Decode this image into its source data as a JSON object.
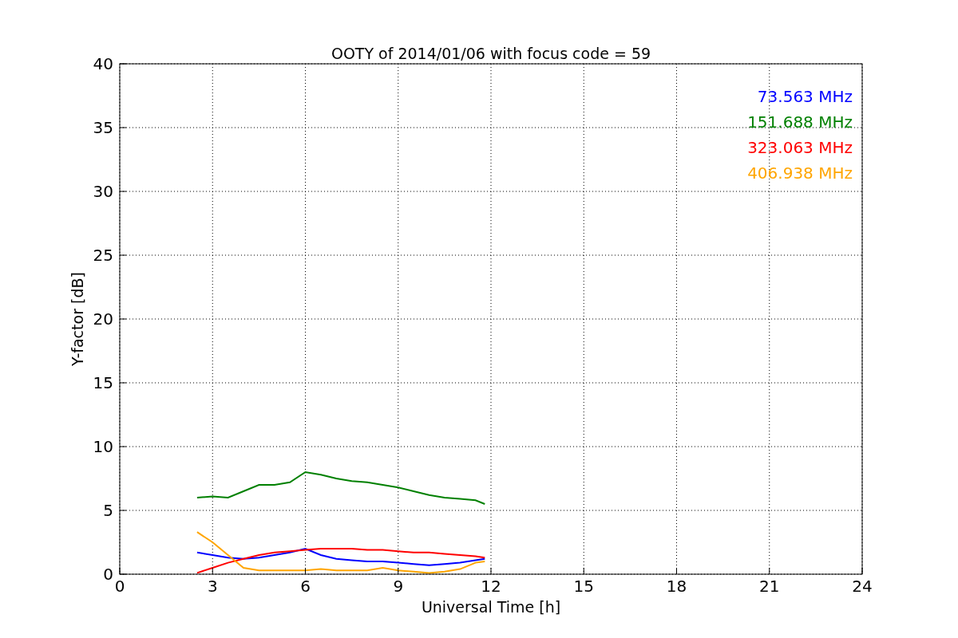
{
  "chart_data": {
    "type": "line",
    "title": "OOTY of 2014/01/06 with focus code = 59",
    "xlabel": "Universal Time [h]",
    "ylabel": "Y-factor [dB]",
    "x": [
      2.5,
      3,
      3.5,
      4,
      4.5,
      5,
      5.5,
      6,
      6.5,
      7,
      7.5,
      8,
      8.5,
      9,
      9.5,
      10,
      10.5,
      11,
      11.5,
      11.8
    ],
    "series": [
      {
        "name": "73.563 MHz",
        "color": "#0000ff",
        "values": [
          1.7,
          1.5,
          1.3,
          1.2,
          1.3,
          1.5,
          1.7,
          2,
          1.5,
          1.2,
          1.1,
          1,
          1,
          0.9,
          0.8,
          0.7,
          0.8,
          0.9,
          1.1,
          1.2
        ]
      },
      {
        "name": "151.688 MHz",
        "color": "#008000",
        "values": [
          6,
          6.1,
          6,
          6.5,
          7,
          7,
          7.2,
          8,
          7.8,
          7.5,
          7.3,
          7.2,
          7,
          6.8,
          6.5,
          6.2,
          6,
          5.9,
          5.8,
          5.5
        ]
      },
      {
        "name": "323.063 MHz",
        "color": "#ff0000",
        "values": [
          0.1,
          0.5,
          0.9,
          1.2,
          1.5,
          1.7,
          1.8,
          1.9,
          2,
          2,
          2,
          1.9,
          1.9,
          1.8,
          1.7,
          1.7,
          1.6,
          1.5,
          1.4,
          1.3
        ]
      },
      {
        "name": "406.938 MHz",
        "color": "#ffa500",
        "values": [
          3.3,
          2.5,
          1.5,
          0.5,
          0.3,
          0.3,
          0.3,
          0.3,
          0.4,
          0.3,
          0.3,
          0.3,
          0.5,
          0.3,
          0.2,
          0.1,
          0.2,
          0.4,
          0.9,
          1.0
        ]
      }
    ],
    "xlim": [
      0,
      24
    ],
    "ylim": [
      0,
      40
    ],
    "xticks": [
      0,
      3,
      6,
      9,
      12,
      15,
      18,
      21,
      24
    ],
    "yticks": [
      0,
      5,
      10,
      15,
      20,
      25,
      30,
      35,
      40
    ],
    "grid": true
  }
}
